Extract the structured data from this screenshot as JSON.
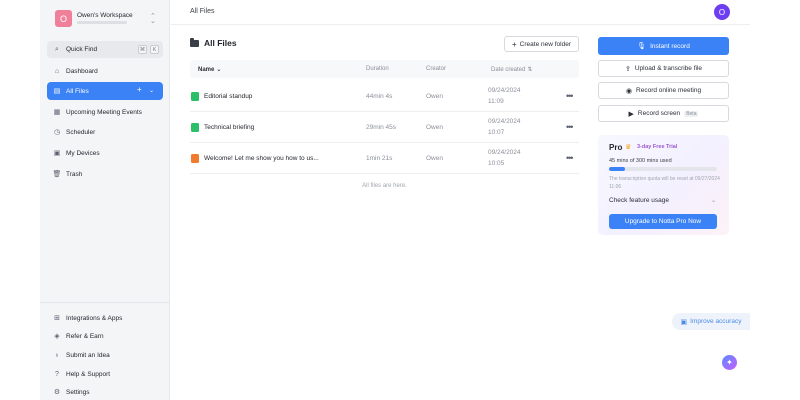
{
  "workspace": {
    "avatar_letter": "O",
    "name": "Owen's Workspace"
  },
  "quick_find": {
    "label": "Quick Find",
    "key1": "⌘",
    "key2": "K"
  },
  "nav": {
    "items": [
      {
        "label": "Dashboard",
        "icon": "home-icon"
      },
      {
        "label": "All Files",
        "icon": "files-icon",
        "active": true
      },
      {
        "label": "Upcoming Meeting Events",
        "icon": "calendar-icon"
      },
      {
        "label": "Scheduler",
        "icon": "scheduler-icon"
      },
      {
        "label": "My Devices",
        "icon": "device-icon"
      },
      {
        "label": "Trash",
        "icon": "trash-icon"
      }
    ],
    "bottom": [
      {
        "label": "Integrations & Apps",
        "icon": "integrations-icon"
      },
      {
        "label": "Refer & Earn",
        "icon": "gift-icon"
      },
      {
        "label": "Submit an Idea",
        "icon": "lightbulb-icon"
      },
      {
        "label": "Help & Support",
        "icon": "help-icon"
      },
      {
        "label": "Settings",
        "icon": "gear-icon"
      }
    ]
  },
  "header": {
    "title": "All Files",
    "user_avatar": "O"
  },
  "main": {
    "title": "All Files",
    "new_folder_label": "Create new folder",
    "columns": {
      "name": "Name",
      "duration": "Duration",
      "creator": "Creator",
      "date": "Date created"
    },
    "files": [
      {
        "name": "Editorial standup",
        "duration": "44min 4s",
        "creator": "Owen",
        "date": "09/24/2024",
        "time": "11:09",
        "type": "doc",
        "color": "#2bbf6a"
      },
      {
        "name": "Technical briefing",
        "duration": "29min 45s",
        "creator": "Owen",
        "date": "09/24/2024",
        "time": "10:07",
        "type": "doc",
        "color": "#2bbf6a"
      },
      {
        "name": "Welcome! Let me show you how to us...",
        "duration": "1min 21s",
        "creator": "Owen",
        "date": "09/24/2024",
        "time": "10:05",
        "type": "video",
        "color": "#f07b2f"
      }
    ],
    "empty_note": "All files are here."
  },
  "actions": {
    "instant_record": "Instant record",
    "upload": "Upload & transcribe file",
    "record_meeting": "Record online meeting",
    "record_screen": "Record screen",
    "beta": "Beta"
  },
  "pro": {
    "title": "Pro",
    "trial": "3-day Free Trial",
    "usage": "45 mins of 300 mins used",
    "usage_fraction": 0.15,
    "reset_text": "The transcription quota will be reset at 09/27/2024 11:06",
    "check_usage": "Check feature usage",
    "upgrade": "Upgrade to Notta Pro Now"
  },
  "improve_accuracy": "Improve accuracy",
  "colors": {
    "accent": "#3b82f6",
    "workspace_avatar": "#f0809a",
    "user_avatar": "#6d3df2"
  }
}
